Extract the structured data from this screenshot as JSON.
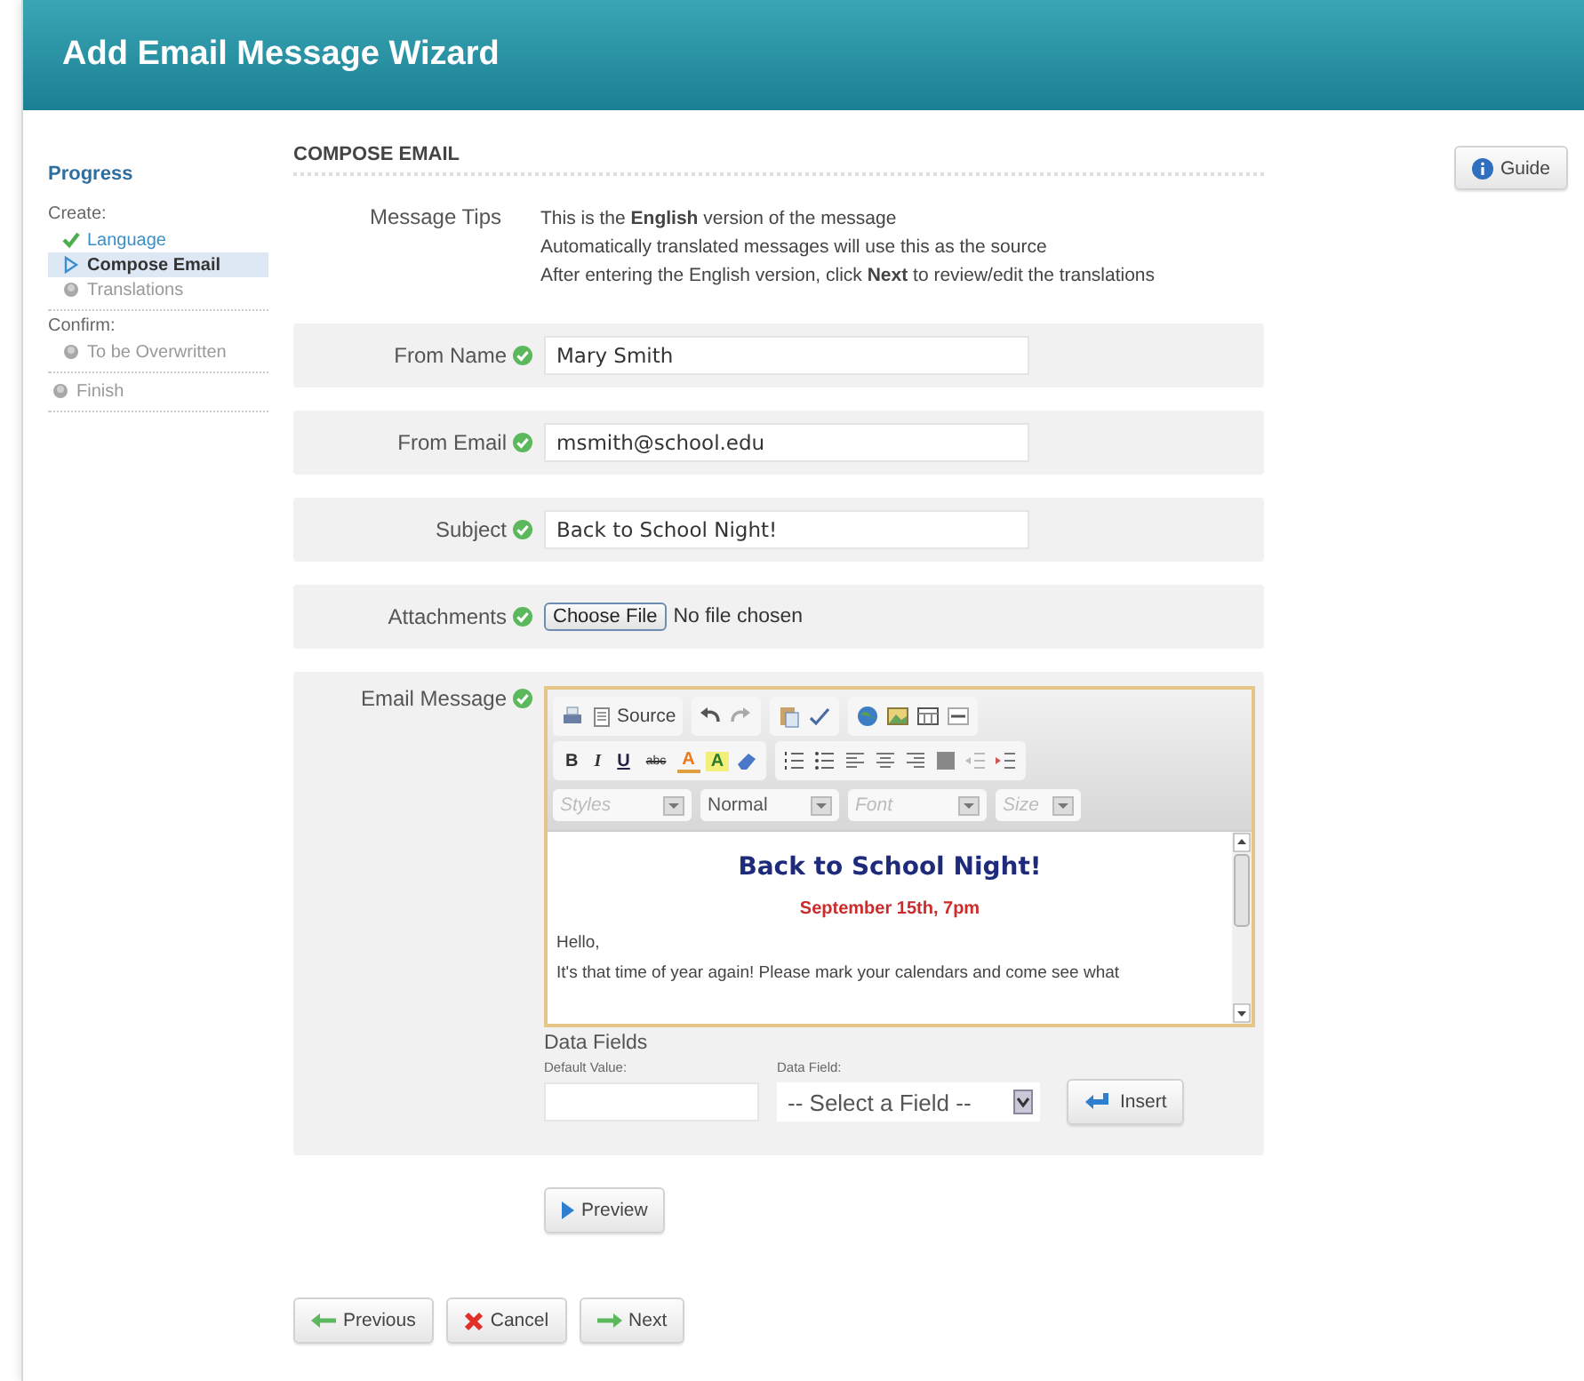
{
  "window": {
    "title": "Add Email Message Wizard"
  },
  "progress": {
    "title": "Progress",
    "sections": [
      {
        "heading": "Create:",
        "steps": [
          {
            "label": "Language",
            "completed": true,
            "selected": false
          },
          {
            "label": "Compose Email",
            "completed": false,
            "selected": true
          },
          {
            "label": "Translations",
            "completed": false,
            "selected": false
          }
        ]
      },
      {
        "heading": "Confirm:",
        "steps": [
          {
            "label": "To be Overwritten",
            "completed": false,
            "selected": false
          }
        ]
      },
      {
        "steps": [
          {
            "label": "Finish",
            "completed": false,
            "selected": false
          }
        ]
      }
    ]
  },
  "section_title": "COMPOSE EMAIL",
  "guide_button": "Guide",
  "tips": {
    "label": "Message Tips",
    "lines": [
      "This is the **English** version of the message",
      "Automatically translated messages will use this as the source",
      "After entering the English version, click **Next** to review/edit the translations"
    ]
  },
  "fields": [
    {
      "kind": "text",
      "label": "From Name",
      "valid": true,
      "value": "Mary Smith"
    },
    {
      "kind": "text",
      "label": "From Email",
      "valid": true,
      "value": "msmith@school.edu"
    },
    {
      "kind": "text",
      "label": "Subject",
      "valid": true,
      "value": "Back to School Night!"
    },
    {
      "kind": "file",
      "label": "Attachments",
      "valid": true,
      "button": "Choose File",
      "status_text": "No file chosen"
    },
    {
      "kind": "editor",
      "label": "Email Message",
      "valid": true
    }
  ],
  "editor": {
    "source_label": "Source",
    "format_buttons": [
      {
        "kind": "bold",
        "text": "B"
      },
      {
        "kind": "italic",
        "text": "I"
      },
      {
        "kind": "underline",
        "text": "U"
      },
      {
        "kind": "strike",
        "text": "abc"
      },
      {
        "kind": "forecolor",
        "text": "A"
      },
      {
        "kind": "backcolor",
        "text": "A"
      }
    ],
    "combos": [
      {
        "placeholder": "Styles"
      },
      {
        "value": "Normal"
      },
      {
        "placeholder": "Font"
      },
      {
        "placeholder": "Size"
      }
    ],
    "content": [
      {
        "kind": "heading",
        "text": "Back to School Night!"
      },
      {
        "kind": "date",
        "text": "September 15th, 7pm"
      },
      {
        "kind": "para",
        "text": "Hello,"
      },
      {
        "kind": "para",
        "text": "It's that time of year again! Please mark your calendars and come see what"
      }
    ]
  },
  "data_fields": {
    "title": "Data Fields",
    "default_label": "Default Value:",
    "field_label": "Data Field:",
    "select": "-- Select a Field --",
    "insert_button": "Insert"
  },
  "preview_button": "Preview",
  "nav_buttons": [
    {
      "kind": "previous",
      "label": "Previous"
    },
    {
      "kind": "cancel",
      "label": "Cancel"
    },
    {
      "kind": "next",
      "label": "Next"
    }
  ]
}
